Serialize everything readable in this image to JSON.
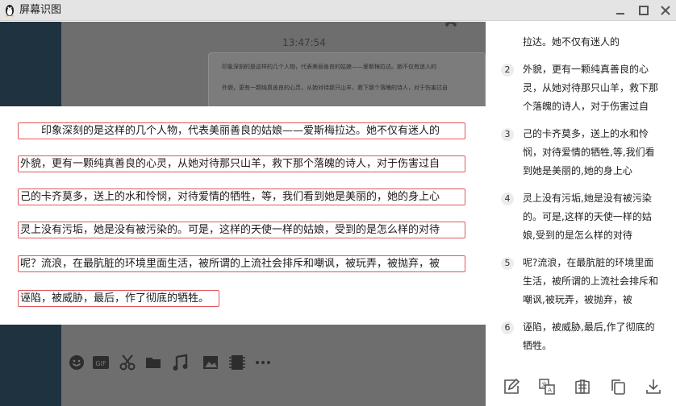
{
  "window": {
    "title": "屏幕识图",
    "icon": "penguin-icon"
  },
  "capture": {
    "time": "13:47:54",
    "bubble_lines": [
      "印象深刻的是这样的几个人物，代表美丽善良的姑娘——爱斯梅拉达。她不仅有迷人的",
      "外貌，更有一颗纯真善良的心灵，从她对待那只山羊，救下那个落魄的诗人，对于伤害过自"
    ],
    "toolbar_icons": [
      "emoji-icon",
      "gif-icon",
      "scissors-icon",
      "folder-icon",
      "music-icon",
      "image-icon",
      "video-icon",
      "more-icon"
    ]
  },
  "ocr": {
    "lines": [
      "印象深刻的是这样的几个人物，代表美丽善良的姑娘——爱斯梅拉达。她不仅有迷人的",
      "外貌，更有一颗纯真善良的心灵，从她对待那只山羊，救下那个落魄的诗人，对于伤害过自",
      "己的卡齐莫多，送上的水和怜悯，对待爱情的牺牲，等，我们看到她是美丽的，她的身上心",
      "灵上没有污垢，她是没有被污染的。可是，这样的天使一样的姑娘，受到的是怎么样的对待",
      "呢？流浪，在最肮脏的环境里面生活，被所谓的上流社会排斥和嘲讽，被玩弄，被抛弃，被",
      "诬陷，被威胁，最后，作了彻底的牺牲。"
    ]
  },
  "results": {
    "items": [
      {
        "num": "",
        "text": "拉达。她不仅有迷人的"
      },
      {
        "num": "2",
        "text": "外貌，更有一颗纯真善良的心\n灵，从她对待那只山羊，救下那\n个落魄的诗人，对于伤害过自"
      },
      {
        "num": "3",
        "text": "己的卡齐莫多，送上的水和怜\n悯，对待爱情的牺牲,等,我们看\n到她是美丽的,她的身上心"
      },
      {
        "num": "4",
        "text": "灵上没有污垢,她是没有被污染\n的。可是,这样的天使一样的姑\n娘,受到的是怎么样的对待"
      },
      {
        "num": "5",
        "text": "呢?流浪，在最肮脏的环境里面\n生活，被所谓的上流社会排斥和\n嘲讽,被玩弄，被抛弃，被"
      },
      {
        "num": "6",
        "text": "诬陷，被威胁,最后,作了彻底的\n牺牲。"
      }
    ],
    "tools": [
      "edit-icon",
      "translate-icon",
      "copy-format-icon",
      "copy-icon",
      "download-icon"
    ]
  },
  "colors": {
    "highlight_border": "#e2575a",
    "navy": "#1f3240"
  }
}
